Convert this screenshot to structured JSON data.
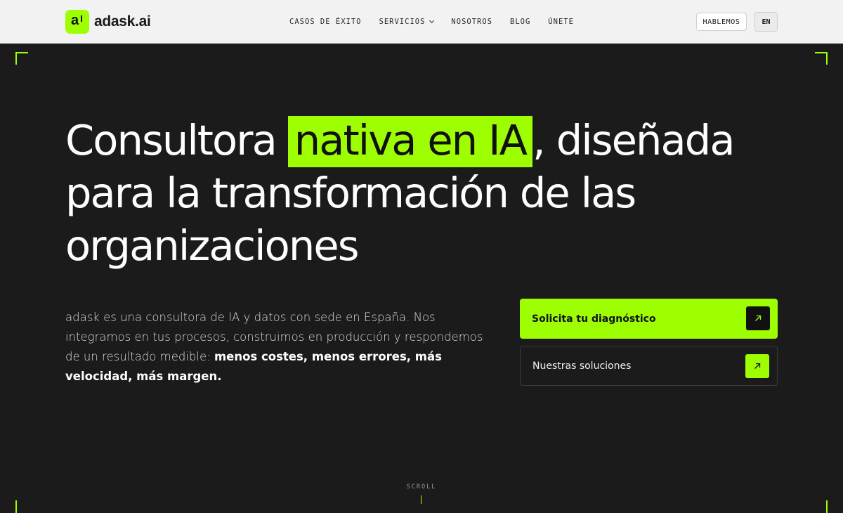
{
  "brand": {
    "logo_mark": "a",
    "name": "adask.ai",
    "accent_color": "#9dff00"
  },
  "nav": {
    "items": [
      {
        "label": "CASOS DE ÉXITO"
      },
      {
        "label": "SERVICIOS",
        "icon": "chevron-down-icon"
      },
      {
        "label": "NOSOTROS"
      },
      {
        "label": "BLOG"
      },
      {
        "label": "ÚNETE"
      }
    ],
    "contact_button": "HABLEMOS",
    "language_button": "EN"
  },
  "hero": {
    "title_before": "Consultora ",
    "title_highlight": "nativa en IA",
    "title_after": ", diseñada para la transformación de las organizaciones",
    "lead_text": "adask es una consultora de IA y datos con sede en España. Nos integramos en tus procesos, construimos en producción y respondemos de un resultado medible: ",
    "lead_emphasis": "menos costes, menos errores, más velocidad, más margen.",
    "primary_cta": {
      "label": "Solicita tu diagnóstico",
      "icon": "arrow-up-right-icon"
    },
    "secondary_cta": {
      "label": "Nuestras soluciones",
      "icon": "arrow-up-right-icon"
    },
    "scroll_label": "SCROLL"
  }
}
